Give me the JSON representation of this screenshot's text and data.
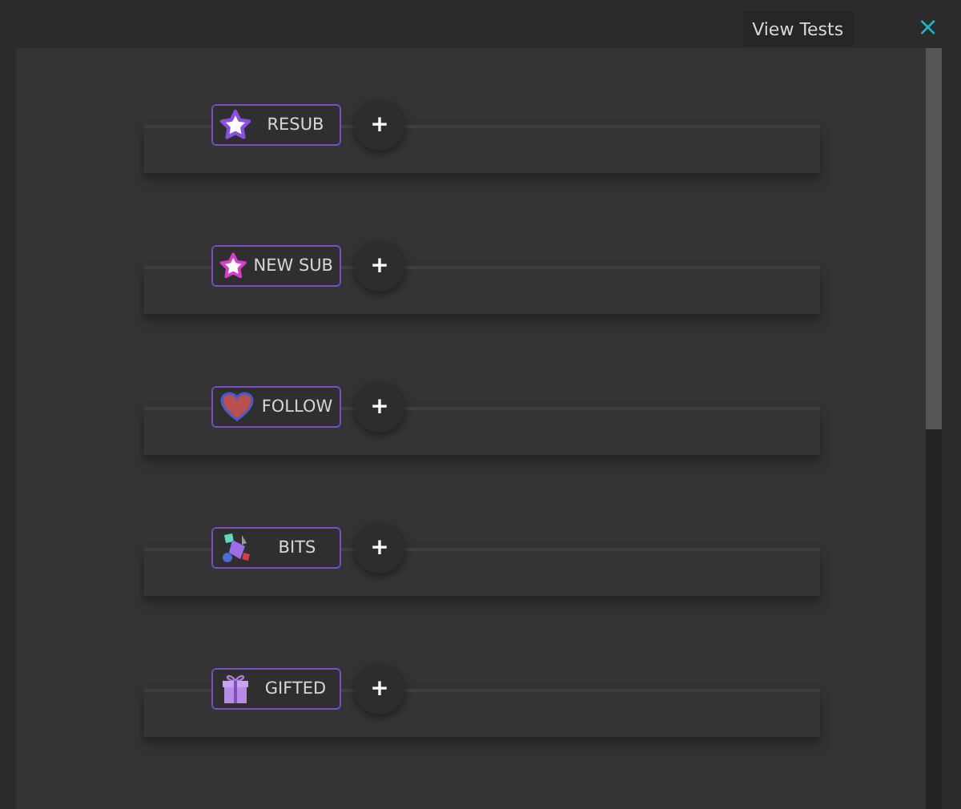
{
  "header": {
    "view_tests": "View Tests",
    "close": "×"
  },
  "events": [
    {
      "kind": "star",
      "color": "#8a4fe0",
      "label": "RESUB",
      "add": "+"
    },
    {
      "kind": "star",
      "color": "#d63fc9",
      "label": "NEW SUB",
      "add": "+"
    },
    {
      "kind": "heart",
      "label": "FOLLOW",
      "add": "+"
    },
    {
      "kind": "bits",
      "label": "BITS",
      "add": "+"
    },
    {
      "kind": "gift",
      "label": "GIFTED",
      "add": "+"
    }
  ]
}
